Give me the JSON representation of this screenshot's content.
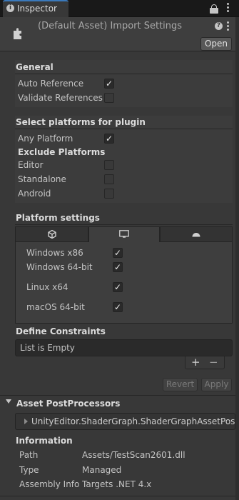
{
  "window": {
    "tab_label": "Inspector",
    "tab_icon_glyph": "i",
    "header_title": "(Default Asset) Import Settings",
    "help_glyph": "?",
    "open_label": "Open"
  },
  "general": {
    "title": "General",
    "auto_reference_label": "Auto Reference",
    "auto_reference_checked": true,
    "validate_references_label": "Validate References",
    "validate_references_checked": false
  },
  "platforms": {
    "title": "Select platforms for plugin",
    "any_platform_label": "Any Platform",
    "any_platform_checked": true,
    "exclude_title": "Exclude Platforms",
    "exclude": [
      {
        "label": "Editor",
        "checked": false
      },
      {
        "label": "Standalone",
        "checked": false
      },
      {
        "label": "Android",
        "checked": false
      }
    ]
  },
  "platform_settings": {
    "title": "Platform settings",
    "tabs": [
      "unity-icon",
      "monitor-icon",
      "android-icon"
    ],
    "active_tab": 1,
    "items": [
      {
        "label": "Windows x86",
        "checked": true
      },
      {
        "label": "Windows 64-bit",
        "checked": true
      },
      {
        "label": "Linux x64",
        "checked": true
      },
      {
        "label": "macOS 64-bit",
        "checked": true
      }
    ]
  },
  "define_constraints": {
    "title": "Define Constraints",
    "empty_text": "List is Empty",
    "add_glyph": "+",
    "remove_glyph": "−"
  },
  "actions": {
    "revert_label": "Revert",
    "apply_label": "Apply"
  },
  "postprocessors": {
    "title": "Asset PostProcessors",
    "item": "UnityEditor.ShaderGraph.ShaderGraphAssetPostPr"
  },
  "information": {
    "title": "Information",
    "rows": [
      {
        "key": "Path",
        "value": "Assets/TestScan2601.dll"
      },
      {
        "key": "Type",
        "value": "Managed"
      },
      {
        "key": "Assembly Info",
        "value": "Targets .NET 4.x"
      }
    ]
  }
}
